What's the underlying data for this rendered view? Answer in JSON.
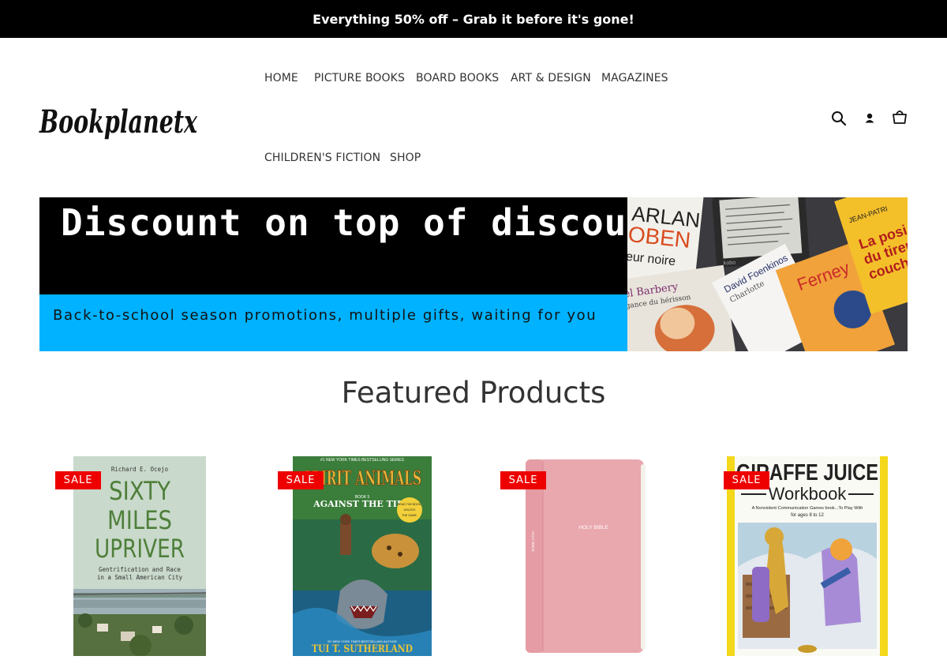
{
  "announcement": "Everything 50% off – Grab it before it's gone!",
  "logo_text": "Bookplanetx",
  "nav": {
    "items": [
      {
        "label": "HOME"
      },
      {
        "label": "PICTURE BOOKS"
      },
      {
        "label": "BOARD BOOKS"
      },
      {
        "label": "ART & DESIGN"
      },
      {
        "label": "MAGAZINES"
      },
      {
        "label": "CHILDREN'S FICTION"
      },
      {
        "label": "SHOP"
      }
    ]
  },
  "header_icons": [
    "search-icon",
    "account-icon",
    "cart-icon"
  ],
  "hero": {
    "title": "Discount on top of discount",
    "subtitle": "Back-to-school season promotions, multiple gifts, waiting for you",
    "photo_texts": [
      "ARLAN",
      "OBEN",
      "eur noire",
      "el Barbery",
      "gance du hérisson",
      "David Foenkinos",
      "Charlotte",
      "Ferney",
      "JEAN-PATRI",
      "La posi",
      "du tireu",
      "couché",
      "kobo"
    ],
    "colors": {
      "top": "#000000",
      "bottom": "#00b2ff"
    }
  },
  "featured": {
    "title": "Featured Products",
    "products": [
      {
        "badge": "SALE",
        "cover": {
          "author": "Richard E. Ocejo",
          "line1": "SIXTY",
          "line2": "MILES",
          "line3": "UPRIVER",
          "subtitle1": "Gentrification and Race",
          "subtitle2": "in a Small American City"
        }
      },
      {
        "badge": "SALE",
        "cover": {
          "banner": "#1 NEW YORK TIMES BESTSELLING SERIES",
          "series": "SPIRIT ANIMALS",
          "book": "BOOK 5",
          "title": "AGAINST THE TIDE",
          "sticker1": "READ THE BOOK.",
          "sticker2": "UNLOCK",
          "sticker3": "THE GAME.",
          "byline": "BY NEW YORK TIMES BESTSELLING AUTHOR",
          "author": "TUI T. SUTHERLAND"
        }
      },
      {
        "badge": "SALE",
        "cover": {
          "title": "HOLY BIBLE",
          "spine": "HOLY BIBLE"
        }
      },
      {
        "badge": "SALE",
        "cover": {
          "title1": "GIRAFFE JUICE",
          "title2": "Workbook",
          "subtitle1": "A Nonviolent Communication Games book...To Play With",
          "subtitle2": "for ages 8 to 12"
        }
      }
    ]
  }
}
